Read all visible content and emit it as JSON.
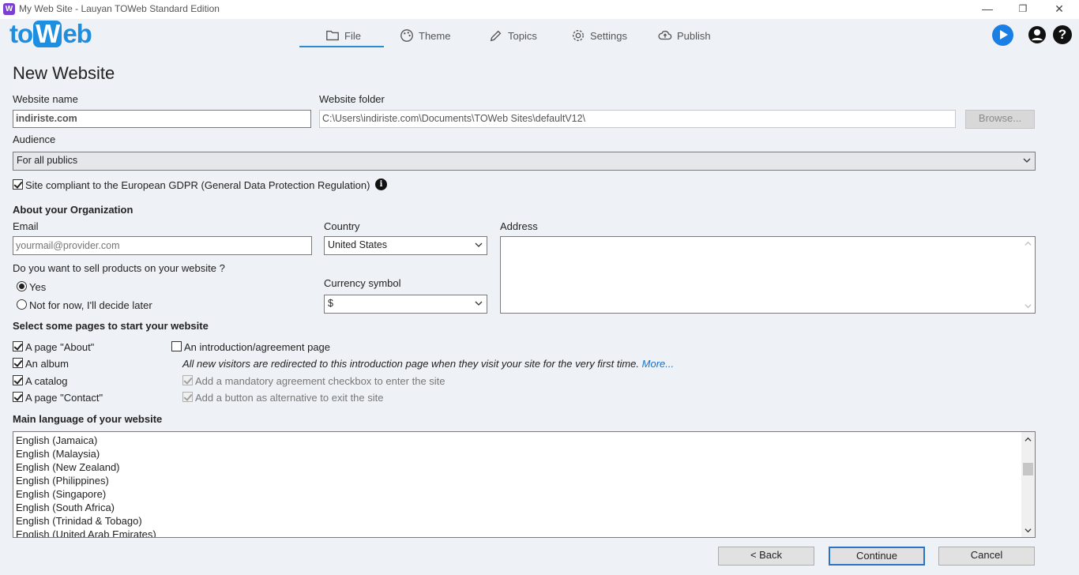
{
  "window": {
    "title": "My Web Site - Lauyan TOWeb Standard Edition",
    "app_icon_letter": "W",
    "minimize": "—",
    "restore": "❐",
    "close": "✕"
  },
  "header": {
    "logo_left": "to",
    "logo_w": "W",
    "logo_right": "eb",
    "tabs": [
      {
        "label": "File",
        "icon": "folder-icon"
      },
      {
        "label": "Theme",
        "icon": "palette-icon"
      },
      {
        "label": "Topics",
        "icon": "pencil-icon"
      },
      {
        "label": "Settings",
        "icon": "gear-icon"
      },
      {
        "label": "Publish",
        "icon": "cloud-upload-icon"
      }
    ],
    "accent": "#1e8fe0",
    "help_glyph": "?"
  },
  "form": {
    "title": "New Website",
    "website_name_label": "Website name",
    "website_name_value": "indiriste.com",
    "website_folder_label": "Website folder",
    "website_folder_value": "C:\\Users\\indiriste.com\\Documents\\TOWeb Sites\\defaultV12\\",
    "browse_label": "Browse...",
    "audience_label": "Audience",
    "audience_value": "For all publics",
    "gdpr_label": "Site compliant to the European GDPR (General Data Protection Regulation)",
    "gdpr_checked": true,
    "info_glyph": "i",
    "org_heading": "About your Organization",
    "email_label": "Email",
    "email_placeholder": "yourmail@provider.com",
    "country_label": "Country",
    "country_value": "United States",
    "address_label": "Address",
    "sell_question": "Do you want to sell products on your website ?",
    "sell_yes": "Yes",
    "sell_no": "Not for now, I'll decide later",
    "currency_label": "Currency symbol",
    "currency_value": "$",
    "pages_heading": "Select some pages to start your website",
    "pages": [
      {
        "label": "A page \"About\"",
        "checked": true
      },
      {
        "label": "An album",
        "checked": true
      },
      {
        "label": "A catalog",
        "checked": true
      },
      {
        "label": "A page \"Contact\"",
        "checked": true
      }
    ],
    "intro_label": "An introduction/agreement page",
    "intro_checked": false,
    "intro_note": "All new visitors are redirected to this introduction page when they visit your site for the very first time.",
    "intro_more": "More...",
    "intro_opt1": "Add a mandatory agreement checkbox to enter the site",
    "intro_opt2": "Add a button as alternative to exit the site",
    "language_heading": "Main language of your website",
    "languages": [
      "English (Jamaica)",
      "English (Malaysia)",
      "English (New Zealand)",
      "English (Philippines)",
      "English (Singapore)",
      "English (South Africa)",
      "English (Trinidad & Tobago)",
      "English (United Arab Emirates)"
    ]
  },
  "footer": {
    "back_label": "< Back",
    "continue_label": "Continue",
    "cancel_label": "Cancel"
  }
}
